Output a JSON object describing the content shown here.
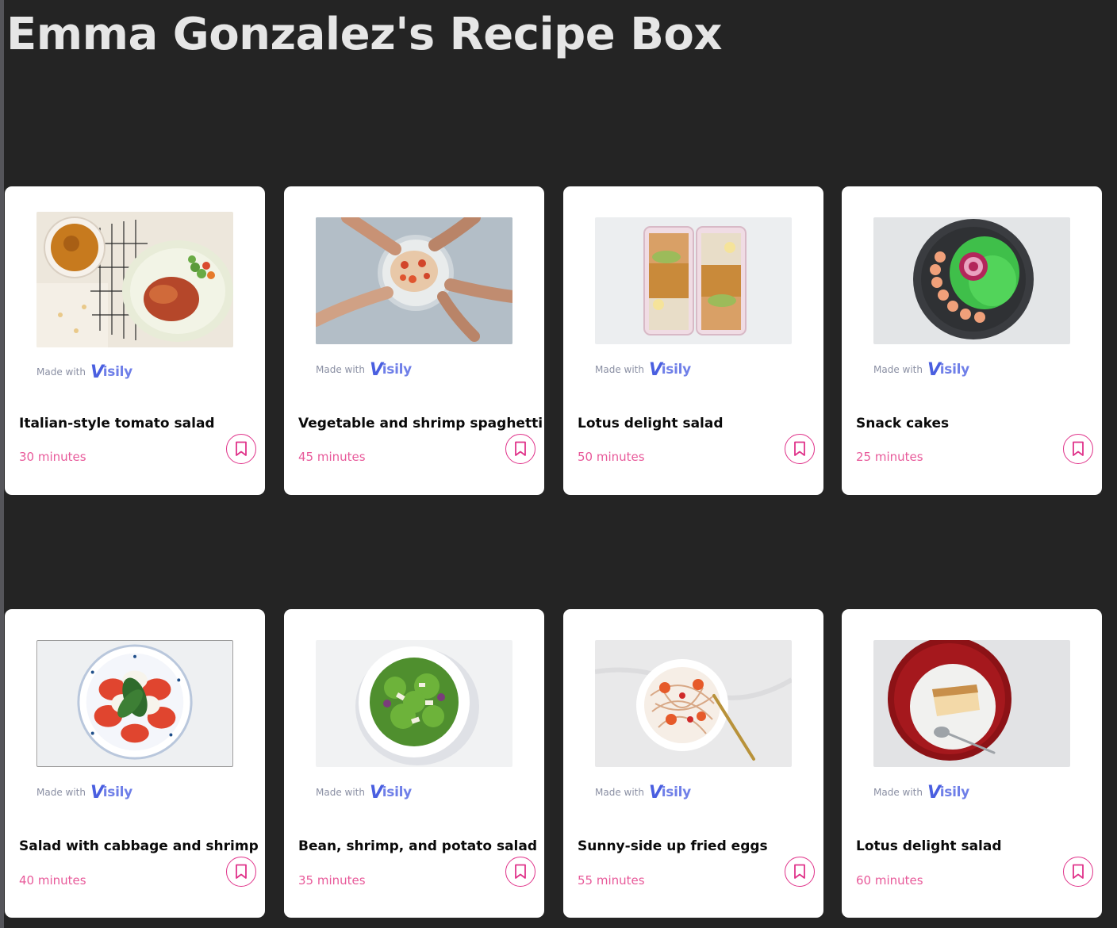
{
  "page": {
    "title": "Emma Gonzalez's Recipe Box"
  },
  "branding": {
    "made_with": "Made with",
    "brand_v": "V",
    "brand_rest": "isily",
    "brand_color": "#5b6ee8"
  },
  "colors": {
    "background": "#242424",
    "card": "#ffffff",
    "accent": "#e0338a",
    "time_text": "#e85a9a"
  },
  "recipes": [
    {
      "title": "Italian-style tomato salad",
      "time": "30 minutes",
      "icon": "bookmark-icon"
    },
    {
      "title": "Vegetable and shrimp spaghetti",
      "time": "45 minutes",
      "icon": "bookmark-icon"
    },
    {
      "title": "Lotus delight salad",
      "time": "50 minutes",
      "icon": "bookmark-icon"
    },
    {
      "title": "Snack cakes",
      "time": "25 minutes",
      "icon": "bookmark-icon"
    },
    {
      "title": "Salad with cabbage and shrimp",
      "time": "40 minutes",
      "icon": "bookmark-icon"
    },
    {
      "title": "Bean, shrimp, and potato salad",
      "time": "35 minutes",
      "icon": "bookmark-icon"
    },
    {
      "title": "Sunny-side up fried eggs",
      "time": "55 minutes",
      "icon": "bookmark-icon"
    },
    {
      "title": "Lotus delight salad",
      "time": "60 minutes",
      "icon": "bookmark-icon"
    }
  ]
}
